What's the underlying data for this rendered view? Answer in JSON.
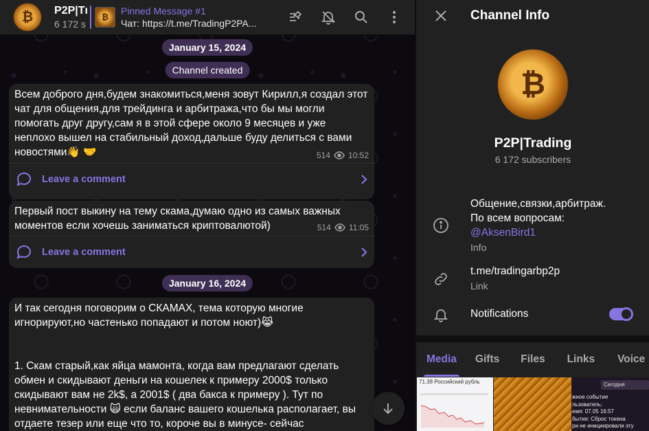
{
  "header": {
    "channel_name": "P2P|Trading",
    "channel_name_visible": "P2P|Tı",
    "subscribers_short": "6 172 s",
    "pinned_title": "Pinned Message #1",
    "pinned_text": "Чат: https://t.me/TradingP2PA..."
  },
  "chat": {
    "date1": "January 15, 2024",
    "system_msg": "Channel created",
    "messages": [
      {
        "text": "Всем доброго дня,будем знакомиться,меня зовут Кирилл,я создал этот чат для общения,для трейдинга и арбитража,что бы мы могли помогать друг другу,сам я в этой сфере около 9 месяцев и уже неплохо вышел на стабильный доход,дальше буду делиться с вами новостями👋 🤝",
        "views": "514",
        "time": "10:52",
        "comment_label": "Leave a comment"
      },
      {
        "text": "Первый пост выкину на тему скама,думаю одно из самых важных моментов если хочешь заниматься криптовалютой)",
        "views": "514",
        "time": "11:05",
        "comment_label": "Leave a comment"
      }
    ],
    "date2": "January 16, 2024",
    "message3": {
      "line1": "И так сегодня поговорим о СКАМАХ, тема которую многие игнорируют,но частенько попадают и потом ноют)😹",
      "line2": "1. Скам старый,как яйца мамонта, когда вам предлагают сделать обмен и скидывают деньги на кошелек к примеру 2000$ только скидывают вам не 2k$, а 2001$ ( два бакса к примеру ). Тут по невнимательности 🙀  если баланс вашего кошелька располагает, вы отдаете тезер или еще что то, короче вы в минусе- сейчас"
    }
  },
  "info": {
    "title": "Channel Info",
    "name": "P2P|Trading",
    "subscribers": "6 172 subscribers",
    "description_line1": "Общение,связки,арбитраж.",
    "description_line2": "По всем вопросам:",
    "description_mention": "@AksenBird1",
    "description_label": "Info",
    "link": "t.me/tradingarbp2p",
    "link_label": "Link",
    "notifications_label": "Notifications",
    "notifications_on": true,
    "tabs": [
      "Media",
      "Gifts",
      "Files",
      "Links",
      "Voice"
    ],
    "active_tab": "Media",
    "media_previews": {
      "chart_title": "71.38 Российский рубль",
      "event_lines": [
        "Сегодня",
        "жное событие",
        "льзователь:",
        "емя: 07.05 16:57",
        "бытие: Сброс токена",
        "ри не инициировали эту"
      ]
    }
  },
  "colors": {
    "accent": "#8774e1",
    "bubble": "#212121",
    "panel": "#212121",
    "chip": "#45335c"
  }
}
